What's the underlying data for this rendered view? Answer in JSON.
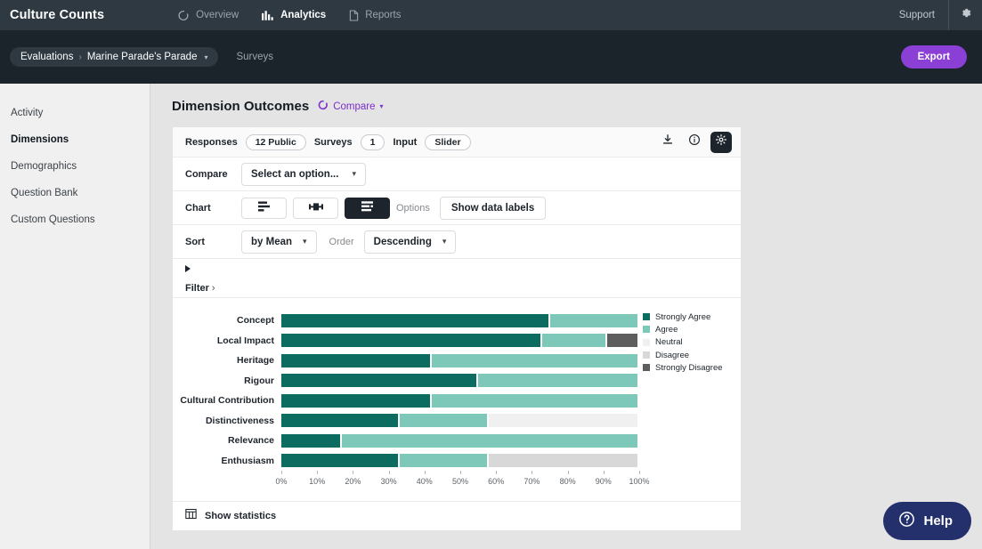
{
  "topnav": {
    "brand": "Culture Counts",
    "items": [
      {
        "label": "Overview",
        "icon": "circle-dashed-icon",
        "active": false
      },
      {
        "label": "Analytics",
        "icon": "bar-chart-icon",
        "active": true
      },
      {
        "label": "Reports",
        "icon": "document-icon",
        "active": false
      }
    ],
    "support_label": "Support",
    "settings_icon": "gear-icon"
  },
  "breadcrumb": {
    "root": "Evaluations",
    "separator": "›",
    "current": "Marine Parade's Parade",
    "caret": "▾",
    "surveys_link": "Surveys",
    "export_label": "Export"
  },
  "sidebar": {
    "items": [
      {
        "label": "Activity",
        "active": false
      },
      {
        "label": "Dimensions",
        "active": true
      },
      {
        "label": "Demographics",
        "active": false
      },
      {
        "label": "Question Bank",
        "active": false
      },
      {
        "label": "Custom Questions",
        "active": false
      }
    ]
  },
  "page": {
    "title": "Dimension Outcomes",
    "compare_label": "Compare",
    "compare_caret": "⌄"
  },
  "meta": {
    "responses_label": "Responses",
    "responses_value": "12 Public",
    "surveys_label": "Surveys",
    "surveys_value": "1",
    "input_label": "Input",
    "input_value": "Slider",
    "icons": {
      "download": "download-icon",
      "info": "info-icon",
      "settings": "gear-icon"
    }
  },
  "controls": {
    "compare_label": "Compare",
    "compare_select_value": "Select an option...",
    "chart_label": "Chart",
    "chart_types": [
      {
        "name": "grouped-bar-chart-icon",
        "active": false
      },
      {
        "name": "box-plot-chart-icon",
        "active": false
      },
      {
        "name": "stacked-bar-chart-icon",
        "active": true
      }
    ],
    "options_label": "Options",
    "show_data_labels": "Show data labels",
    "sort_label": "Sort",
    "sort_value": "by Mean",
    "order_label": "Order",
    "order_value": "Descending",
    "filter_label": "Filter",
    "filter_chevron": "›"
  },
  "chart_data": {
    "type": "bar",
    "title": "Dimension Outcomes",
    "orientation": "horizontal",
    "stacked": true,
    "normalized": true,
    "xlabel": "",
    "ylabel": "",
    "xlim": [
      0,
      100
    ],
    "xticks": [
      0,
      10,
      20,
      30,
      40,
      50,
      60,
      70,
      80,
      90,
      100
    ],
    "xtick_labels": [
      "0%",
      "10%",
      "20%",
      "30%",
      "40%",
      "50%",
      "60%",
      "70%",
      "80%",
      "90%",
      "100%"
    ],
    "grid": false,
    "legend_position": "right",
    "categories": [
      "Concept",
      "Local Impact",
      "Heritage",
      "Rigour",
      "Cultural Contribution",
      "Distinctiveness",
      "Relevance",
      "Enthusiasm"
    ],
    "series": [
      {
        "name": "Strongly Agree",
        "color": "#0c6c60",
        "values": [
          75,
          73,
          42,
          55,
          42,
          33,
          17,
          33
        ]
      },
      {
        "name": "Agree",
        "color": "#7ec8b9",
        "values": [
          25,
          18,
          58,
          45,
          58,
          25,
          83,
          25
        ]
      },
      {
        "name": "Neutral",
        "color": "#f0f0f0",
        "values": [
          0,
          0,
          0,
          0,
          0,
          42,
          0,
          0
        ]
      },
      {
        "name": "Disagree",
        "color": "#d8d8d8",
        "values": [
          0,
          0,
          0,
          0,
          0,
          0,
          0,
          42
        ]
      },
      {
        "name": "Strongly Disagree",
        "color": "#5e5e5e",
        "values": [
          0,
          9,
          0,
          0,
          0,
          0,
          0,
          0
        ]
      }
    ]
  },
  "footer": {
    "show_statistics": "Show statistics",
    "statistics_icon": "table-icon"
  },
  "help": {
    "label": "Help",
    "icon": "question-circle-icon"
  },
  "colors": {
    "accent_purple": "#8b3fd4",
    "nav_dark": "#2e3942",
    "crumb_dark": "#1c242b",
    "help_navy": "#24306b"
  }
}
